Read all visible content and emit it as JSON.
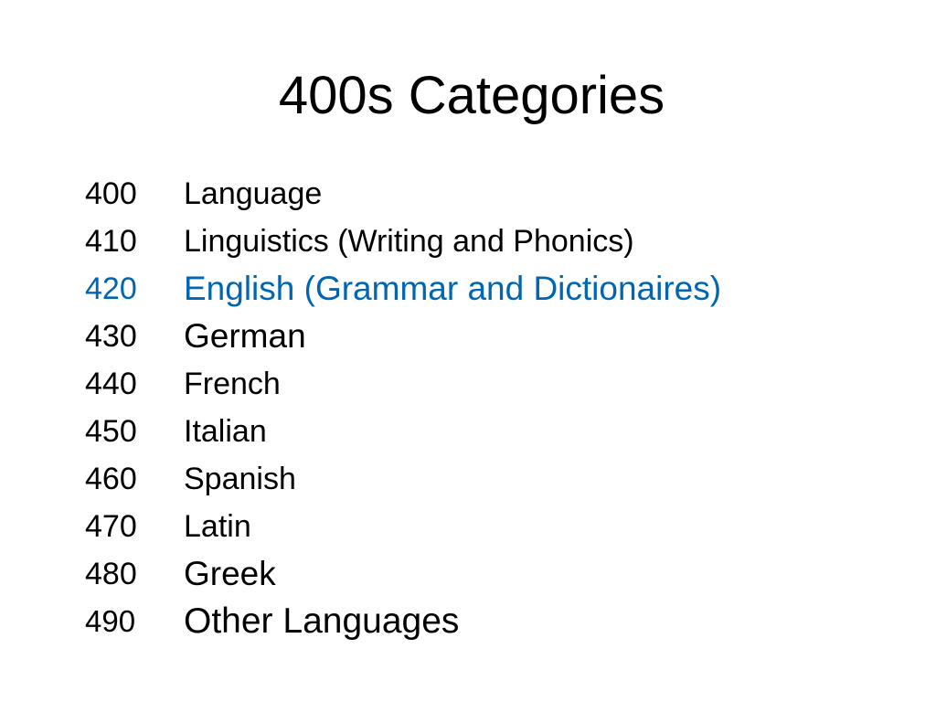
{
  "slide": {
    "title": "400s Categories",
    "highlight_color": "#0066b3",
    "text_color": "#000000",
    "categories": [
      {
        "code": "400",
        "name": "Language",
        "highlighted": false
      },
      {
        "code": "410",
        "name": "Linguistics (Writing and Phonics)",
        "highlighted": false
      },
      {
        "code": "420",
        "name": "English (Grammar and Dictionaires)",
        "highlighted": true
      },
      {
        "code": "430",
        "name": "German",
        "highlighted": false
      },
      {
        "code": "440",
        "name": "French",
        "highlighted": false
      },
      {
        "code": "450",
        "name": "Italian",
        "highlighted": false
      },
      {
        "code": "460",
        "name": "Spanish",
        "highlighted": false
      },
      {
        "code": "470",
        "name": "Latin",
        "highlighted": false
      },
      {
        "code": "480",
        "name": "Greek",
        "highlighted": false
      },
      {
        "code": "490",
        "name": "Other Languages",
        "highlighted": false
      }
    ]
  }
}
